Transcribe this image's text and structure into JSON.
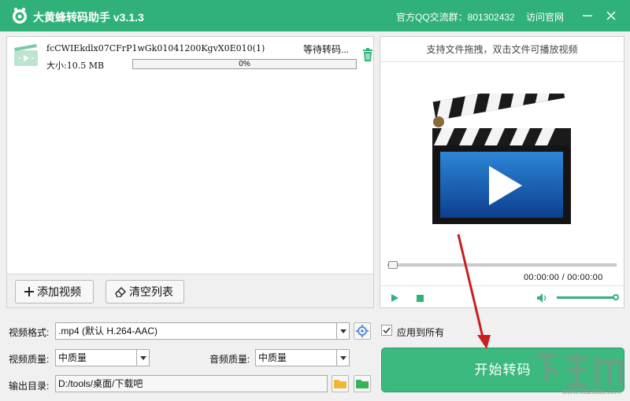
{
  "window": {
    "title": "大黄蜂转码助手 v3.1.3",
    "qq_group": "官方QQ交流群：801302432",
    "visit_site": "访问官网",
    "icons": [
      "bee-logo-icon",
      "minimize-icon",
      "close-icon"
    ]
  },
  "file_list": {
    "items": [
      {
        "name": "fcCWIEkdlx07CFrP1wGk01041200KgvX0E010(1)",
        "status": "等待转码...",
        "size": "大小:10.5 MB",
        "progress_text": "0%",
        "progress": 0
      }
    ],
    "add_button": "添加视频",
    "clear_button": "清空列表"
  },
  "preview": {
    "hint": "支持文件拖拽，双击文件可播放视频",
    "time": "00:00:00 / 00:00:00",
    "seek_position": 0,
    "volume": 1.0
  },
  "settings": {
    "format_label": "视频格式:",
    "format_value": ".mp4 (默认 H.264-AAC)",
    "apply_all_label": "应用到所有",
    "apply_all_checked": true,
    "video_quality_label": "视频质量:",
    "video_quality_value": "中质量",
    "audio_quality_label": "音频质量:",
    "audio_quality_value": "中质量",
    "output_label": "输出目录:",
    "output_value": "D:/tools/桌面/下载吧"
  },
  "start_button": "开始转码",
  "watermark": {
    "url": "www.xiazaiba.com"
  },
  "colors": {
    "brand_green": "#2fb179",
    "annotation_red": "#c81e1e"
  }
}
